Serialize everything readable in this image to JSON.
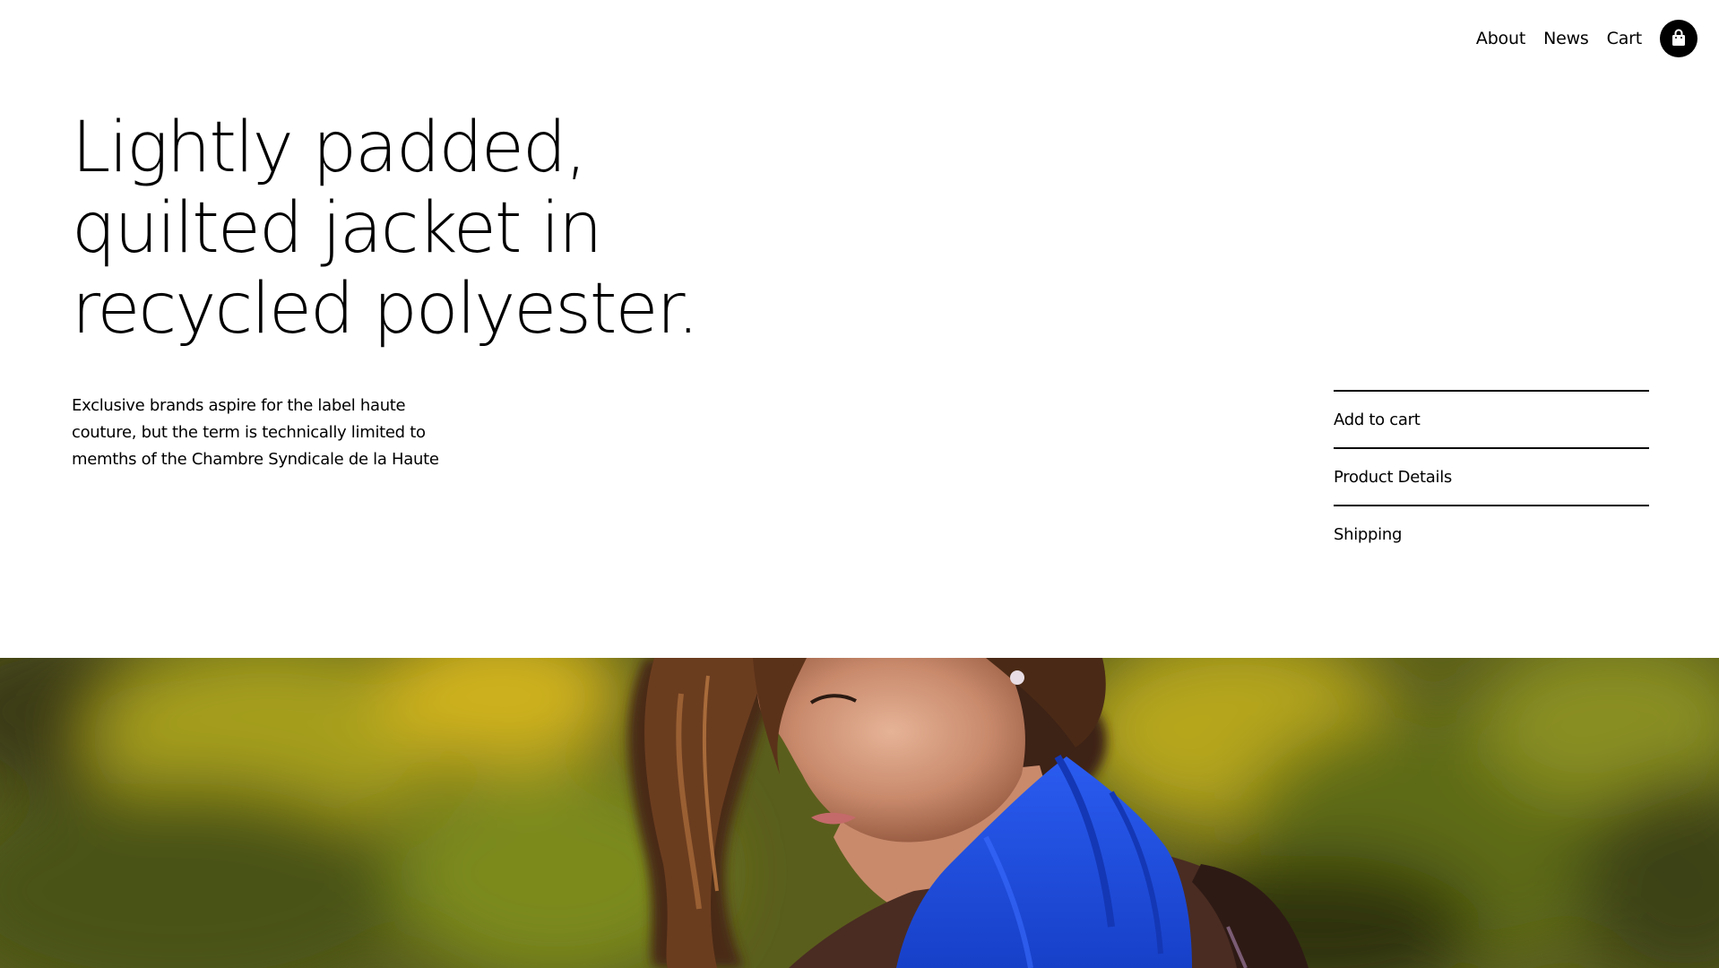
{
  "nav": {
    "links": [
      "About",
      "News",
      "Cart"
    ],
    "cart_icon": "shopping-bag-icon"
  },
  "hero": {
    "title_lines": [
      "Lightly padded,",
      "quilted jacket in",
      "recycled polyester."
    ],
    "description_lines": [
      "Exclusive brands aspire for the label haute",
      "couture, but the term is technically limited to",
      "memths of the Chambre Syndicale de la Haute"
    ]
  },
  "accordion": {
    "items": [
      "Add to cart",
      "Product Details",
      "Shipping"
    ]
  },
  "banner": {
    "image": "woman-in-blue-scarf-photo"
  },
  "colors": {
    "text": "#000000",
    "background": "#ffffff",
    "scarf_blue": "#1f4fe0",
    "foliage_green": "#6f7d18",
    "foliage_yellow": "#c9a81a"
  }
}
